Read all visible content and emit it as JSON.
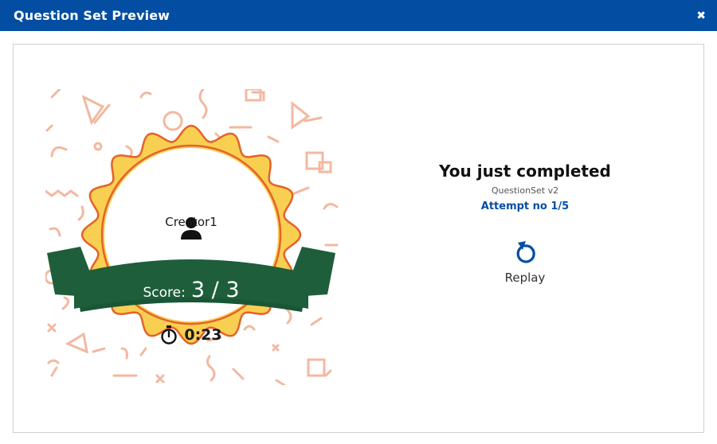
{
  "header": {
    "title": "Question Set Preview",
    "close_icon": "close-icon",
    "background": "#034ea2"
  },
  "badge": {
    "user_icon": "person-icon",
    "creator": "Creator1",
    "score_label": "Score:",
    "score_value": "3 / 3",
    "timer_icon": "stopwatch-icon",
    "time": "0:23",
    "ribbon_color": "#1e5e3b",
    "seal_color": "#f9cf52",
    "seal_border_color": "#e4622a"
  },
  "summary": {
    "headline": "You just completed",
    "subtitle": "QuestionSet v2",
    "attempt": "Attempt no 1/5"
  },
  "replay": {
    "icon": "replay-icon",
    "label": "Replay",
    "icon_color": "#034ea2"
  }
}
